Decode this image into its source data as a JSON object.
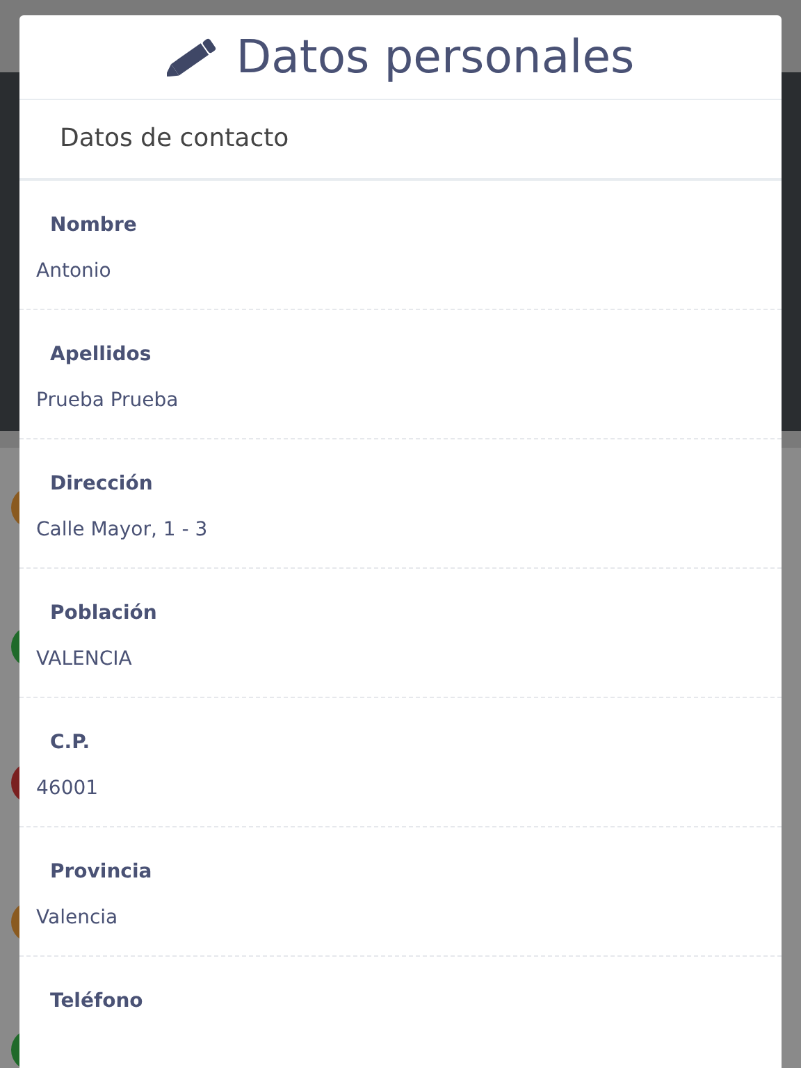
{
  "dialog": {
    "title": "Datos personales",
    "section": "Datos de contacto",
    "fields": [
      {
        "label": "Nombre",
        "value": "Antonio"
      },
      {
        "label": "Apellidos",
        "value": "Prueba Prueba"
      },
      {
        "label": "Dirección",
        "value": "Calle Mayor, 1 - 3"
      },
      {
        "label": "Población",
        "value": "VALENCIA"
      },
      {
        "label": "C.P.",
        "value": "46001"
      },
      {
        "label": "Provincia",
        "value": "Valencia"
      },
      {
        "label": "Teléfono"
      }
    ]
  }
}
